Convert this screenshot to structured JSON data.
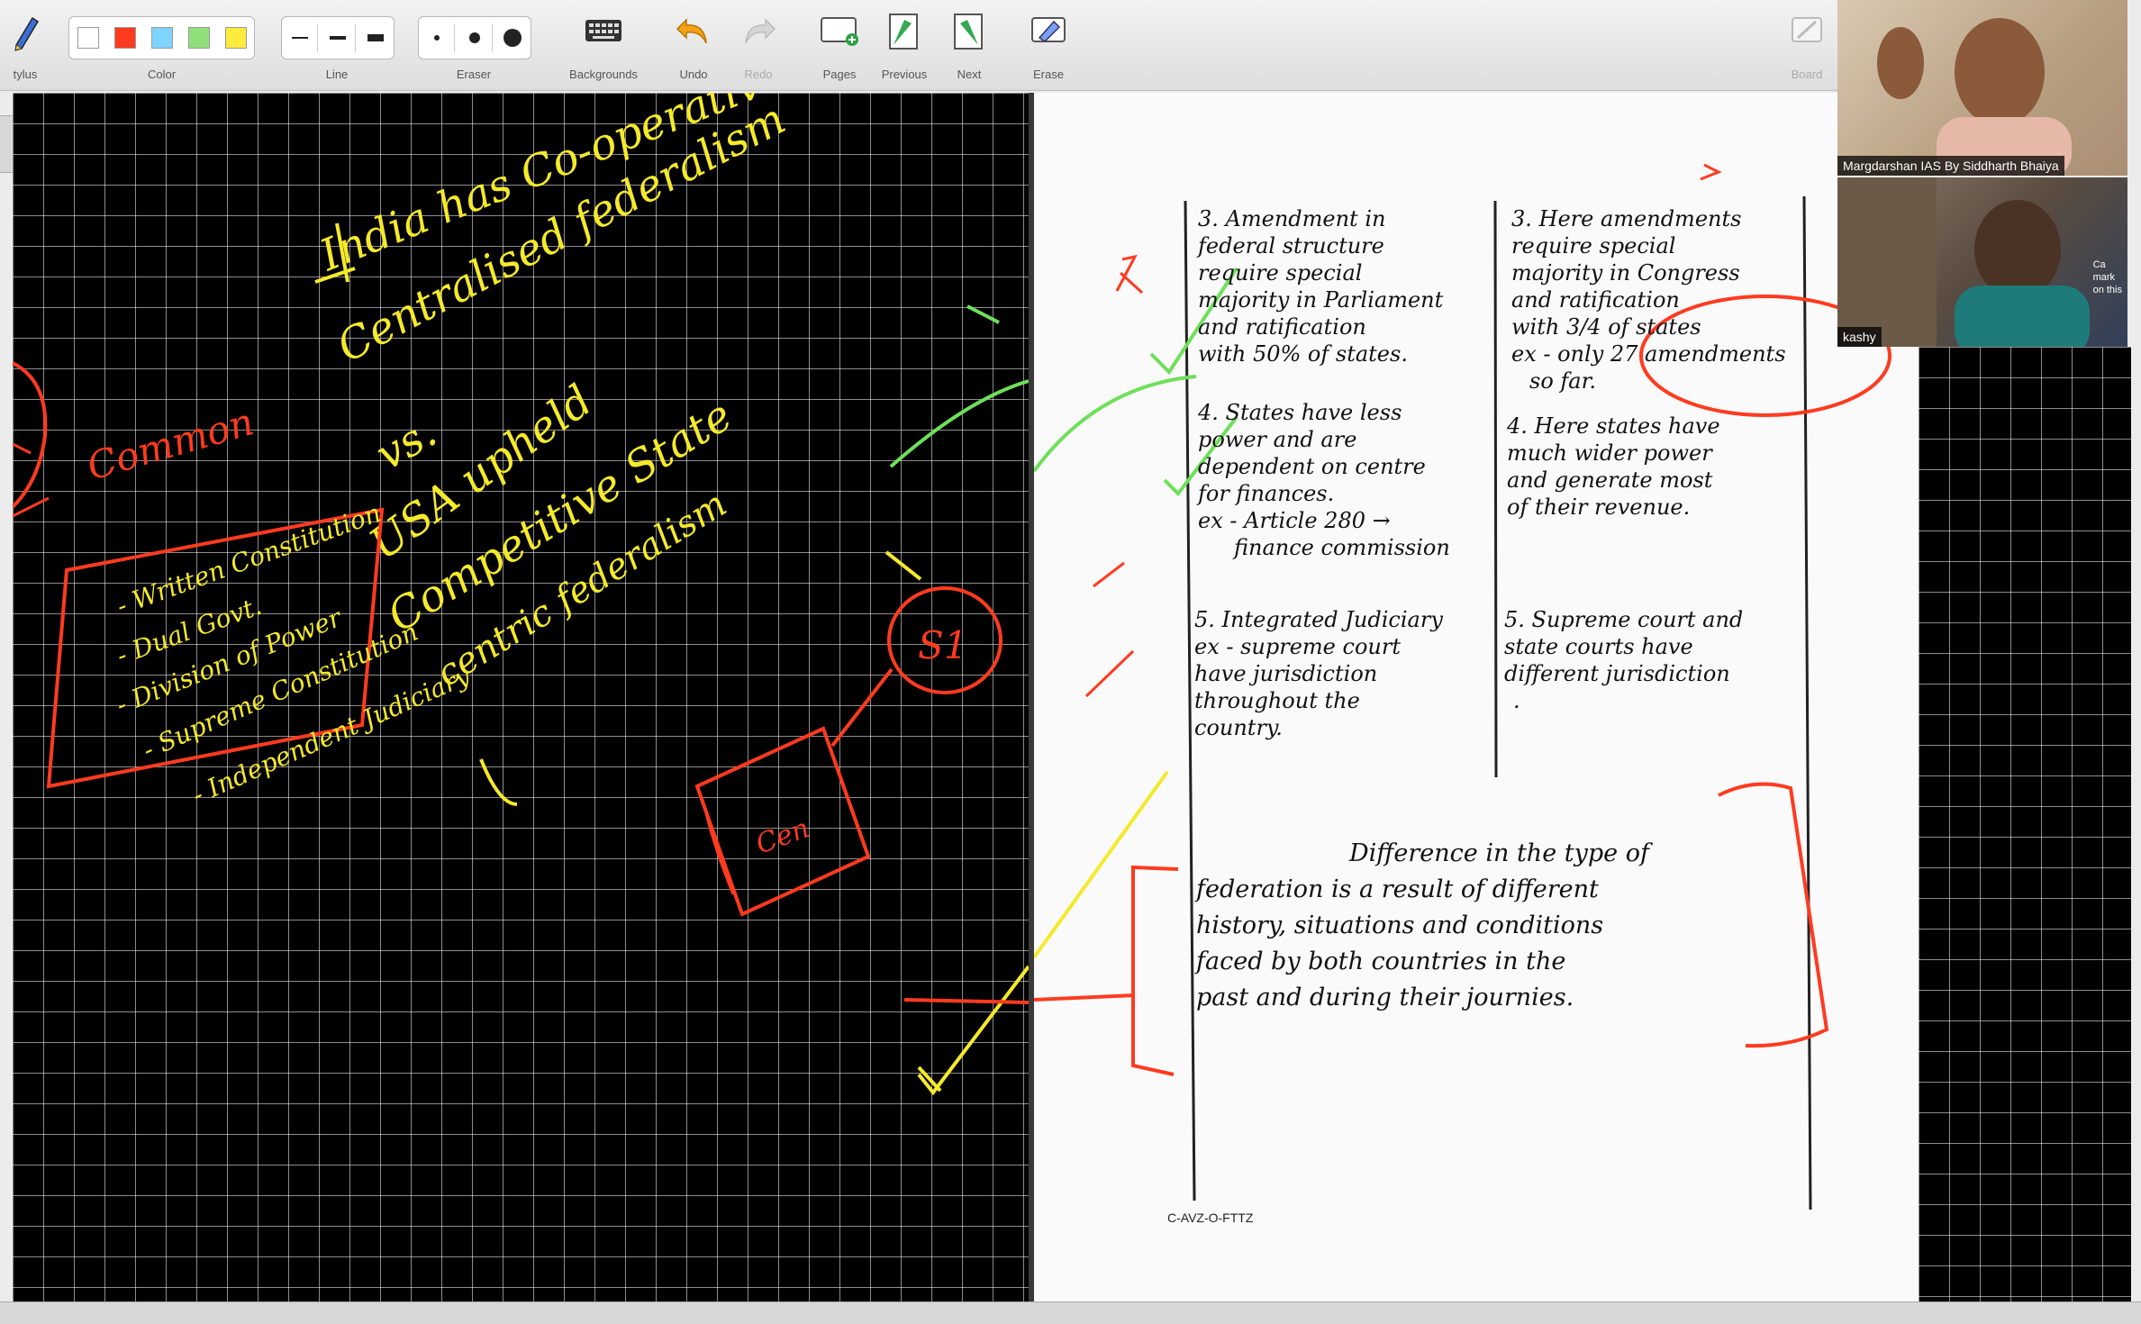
{
  "toolbar": {
    "stylus_label": "tylus",
    "color_label": "Color",
    "line_label": "Line",
    "eraser_label": "Eraser",
    "backgrounds_label": "Backgrounds",
    "undo_label": "Undo",
    "redo_label": "Redo",
    "pages_label": "Pages",
    "previous_label": "Previous",
    "next_label": "Next",
    "erase_label": "Erase",
    "board_label": "Board",
    "colors": [
      "#ffffff",
      "#ff3b1f",
      "#7fd3ff",
      "#8fe07a",
      "#ffeb3b"
    ]
  },
  "whiteboard": {
    "heading_line1": "India has Co-operative",
    "heading_line2": "Centralised federalism",
    "vs": "vs.",
    "usa_line1": "USA upheld",
    "usa_line2": "Competitive State",
    "usa_line3": "centric federalism",
    "common_label": "Common",
    "list": [
      "- Written Constitution",
      "- Dual Govt.",
      "- Division of Power",
      "- Supreme Constitution",
      "- Independent Judiciary"
    ],
    "centre_box": "Cen",
    "state_circle": "S1"
  },
  "paper": {
    "row3_india": [
      "3. Amendment in",
      "federal structure",
      "require special",
      "majority in Parliament",
      "and ratification",
      "with 50% of states."
    ],
    "row3_usa": [
      "3. Here amendments",
      "require special",
      "majority in Congress",
      "and ratification",
      "with 3/4 of states",
      "ex - only 27 amendments",
      "so far."
    ],
    "row4_india": [
      "4. States have less",
      "power and are",
      "dependent on centre",
      "for finances.",
      "ex - Article 280 →",
      "finance commission"
    ],
    "row4_usa": [
      "4. Here states have",
      "much wider power",
      "and generate most",
      "of their revenue."
    ],
    "row5_india": [
      "5. Integrated Judiciary",
      "ex - supreme court",
      "have jurisdiction",
      "throughout the",
      "country."
    ],
    "row5_usa": [
      "5. Supreme court and",
      "state courts have",
      "different jurisdiction",
      "."
    ],
    "conclusion": [
      "Difference in the type of",
      "federation is a result of different",
      "history, situations and conditions",
      "faced by both countries in the",
      "past and during their journies."
    ],
    "code": "C-AVZ-O-FTTZ"
  },
  "video": {
    "host_name": "Margdarshan IAS By Siddharth Bhaiya",
    "participant_name": "kashy",
    "side_fragments": [
      "Ca",
      "mark",
      "on this"
    ]
  }
}
